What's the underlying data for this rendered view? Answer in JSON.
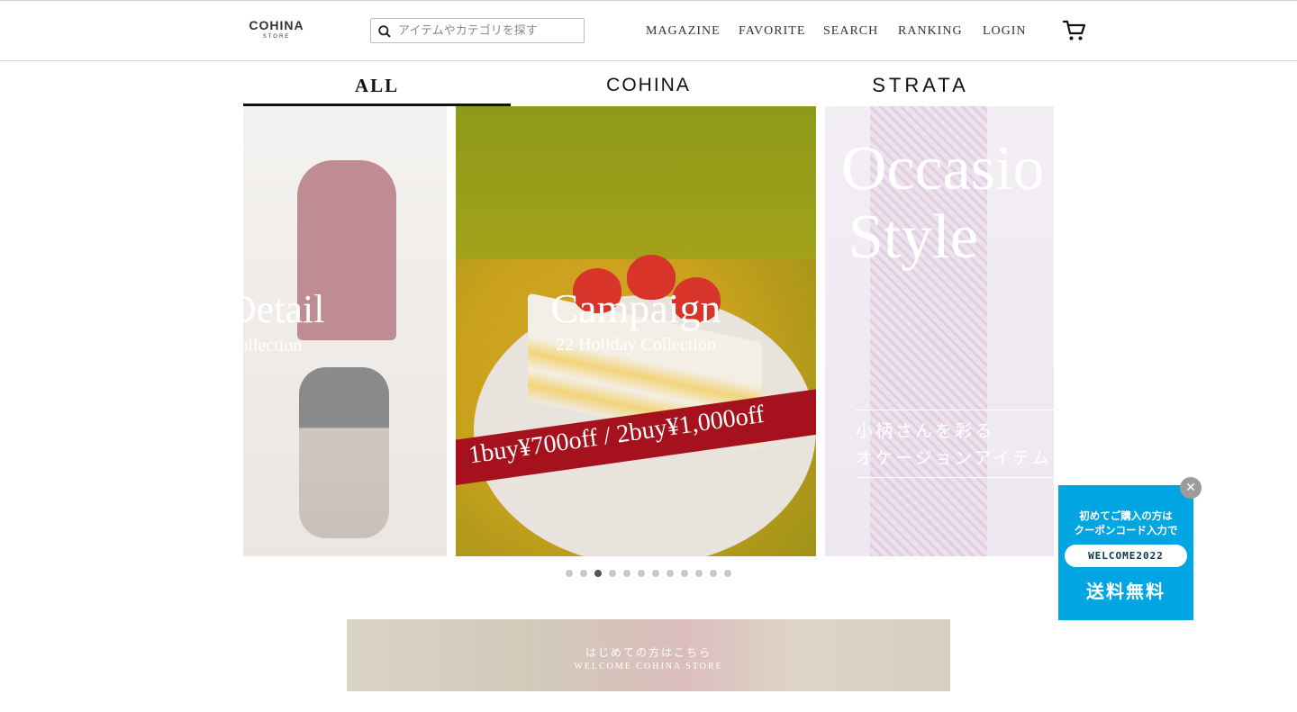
{
  "header": {
    "logo_main": "COHINA",
    "logo_sub": "STORE",
    "search_placeholder": "アイテムやカテゴリを探す",
    "nav": [
      "MAGAZINE",
      "FAVORITE",
      "SEARCH",
      "RANKING",
      "LOGIN"
    ],
    "cart_icon": "cart-icon"
  },
  "brand_tabs": [
    {
      "label": "ALL",
      "active": true
    },
    {
      "label": "COHINA",
      "active": false
    },
    {
      "label": "STRATA",
      "active": false
    }
  ],
  "slides": [
    {
      "title": "n Detail",
      "subtitle": "ay Collection"
    },
    {
      "title": "Campaign",
      "subtitle": "22 Holiday Collection",
      "ribbon": "1buy¥700off / 2buy¥1,000off"
    },
    {
      "title_line1": "Occasio",
      "title_line2": "Style",
      "jp_line1": "小柄さんを彩る",
      "jp_line2": "オケージョンアイテム"
    }
  ],
  "carousel": {
    "dot_count": 12,
    "active_index": 2
  },
  "welcome_banner": {
    "jp": "はじめての方はこちら",
    "en": "WELCOME COHINA STORE"
  },
  "coupon_popup": {
    "line1": "初めてご購入の方は",
    "line2": "クーポンコード入力で",
    "code": "WELCOME2022",
    "benefit": "送料無料",
    "close_icon": "close-icon"
  },
  "colors": {
    "accent": "#00a5e1",
    "ribbon": "#a5121d",
    "dot_active": "#555555",
    "dot_inactive": "#c8c8c8"
  }
}
